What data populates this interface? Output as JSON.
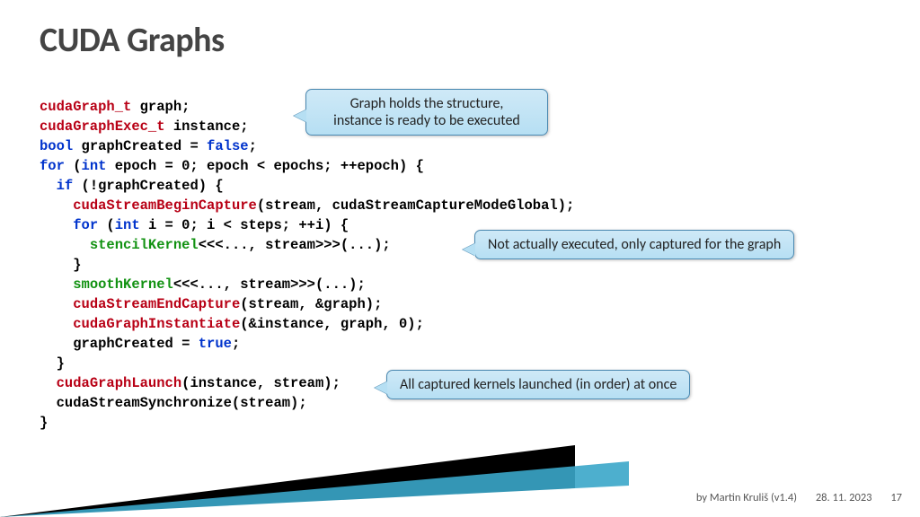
{
  "title": "CUDA Graphs",
  "callouts": {
    "c1": "Graph holds the structure,\ninstance is ready to be executed",
    "c2": "Not actually executed, only captured for the graph",
    "c3": "All captured kernels launched (in order) at once"
  },
  "code_tokens": [
    [
      {
        "t": "cudaGraph_t",
        "c": "type"
      },
      {
        "t": " graph;",
        "c": ""
      }
    ],
    [
      {
        "t": "cudaGraphExec_t",
        "c": "type"
      },
      {
        "t": " instance;",
        "c": ""
      }
    ],
    [
      {
        "t": "bool",
        "c": "kw"
      },
      {
        "t": " graphCreated = ",
        "c": ""
      },
      {
        "t": "false",
        "c": "kw"
      },
      {
        "t": ";",
        "c": ""
      }
    ],
    [
      {
        "t": "for",
        "c": "kw"
      },
      {
        "t": " (",
        "c": ""
      },
      {
        "t": "int",
        "c": "kw"
      },
      {
        "t": " epoch = 0; epoch < epochs; ++epoch) {",
        "c": ""
      }
    ],
    [
      {
        "t": "  ",
        "c": ""
      },
      {
        "t": "if",
        "c": "kw"
      },
      {
        "t": " (!graphCreated) {",
        "c": ""
      }
    ],
    [
      {
        "t": "    ",
        "c": ""
      },
      {
        "t": "cudaStreamBeginCapture",
        "c": "func"
      },
      {
        "t": "(stream, cudaStreamCaptureModeGlobal);",
        "c": ""
      }
    ],
    [
      {
        "t": "    ",
        "c": ""
      },
      {
        "t": "for",
        "c": "kw"
      },
      {
        "t": " (",
        "c": ""
      },
      {
        "t": "int",
        "c": "kw"
      },
      {
        "t": " i = 0; i < steps; ++i) {",
        "c": ""
      }
    ],
    [
      {
        "t": "      ",
        "c": ""
      },
      {
        "t": "stencilKernel",
        "c": "kern"
      },
      {
        "t": "<<<..., stream>>>(...);",
        "c": ""
      }
    ],
    [
      {
        "t": "    }",
        "c": ""
      }
    ],
    [
      {
        "t": "    ",
        "c": ""
      },
      {
        "t": "smoothKernel",
        "c": "kern"
      },
      {
        "t": "<<<..., stream>>>(...);",
        "c": ""
      }
    ],
    [
      {
        "t": "    ",
        "c": ""
      },
      {
        "t": "cudaStreamEndCapture",
        "c": "func"
      },
      {
        "t": "(stream, &graph);",
        "c": ""
      }
    ],
    [
      {
        "t": "    ",
        "c": ""
      },
      {
        "t": "cudaGraphInstantiate",
        "c": "func"
      },
      {
        "t": "(&instance, graph, 0);",
        "c": ""
      }
    ],
    [
      {
        "t": "    graphCreated = ",
        "c": ""
      },
      {
        "t": "true",
        "c": "kw"
      },
      {
        "t": ";",
        "c": ""
      }
    ],
    [
      {
        "t": "  }",
        "c": ""
      }
    ],
    [
      {
        "t": "  ",
        "c": ""
      },
      {
        "t": "cudaGraphLaunch",
        "c": "func"
      },
      {
        "t": "(instance, stream);",
        "c": ""
      }
    ],
    [
      {
        "t": "  cudaStreamSynchronize(stream);",
        "c": ""
      }
    ],
    [
      {
        "t": "}",
        "c": ""
      }
    ]
  ],
  "footer": {
    "author": "by Martin Kruliš (v1.4)",
    "date": "28. 11. 2023",
    "page": "17"
  }
}
